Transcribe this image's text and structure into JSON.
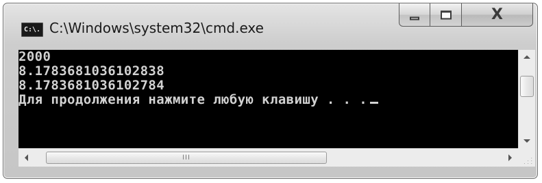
{
  "window": {
    "title": "C:\\Windows\\system32\\cmd.exe",
    "icon": "cmd-icon",
    "icon_text": "C:\\.",
    "controls": {
      "minimize": "minimize-icon",
      "maximize": "maximize-icon",
      "close": "close-icon",
      "close_glyph": "X"
    }
  },
  "console": {
    "background": "#000000",
    "foreground": "#d2d2d2",
    "lines": [
      "2000",
      "8.1783681036102838",
      "8.1783681036102784",
      "Для продолжения нажмите любую клавишу . . ."
    ]
  },
  "scrollbars": {
    "horizontal_grip": "III"
  }
}
